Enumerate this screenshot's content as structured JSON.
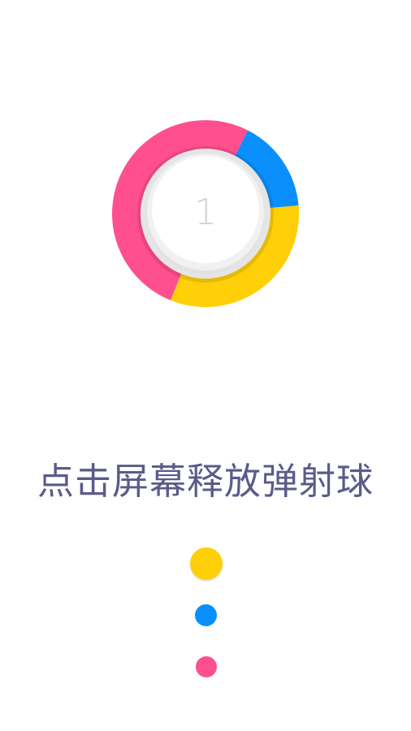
{
  "colors": {
    "pink": "#ff4f8e",
    "blue": "#0a8ffc",
    "yellow": "#ffcf07",
    "background": "#ffffff",
    "text": "#5b5b8a",
    "center_disc": "#ffffff",
    "score_text": "#d2d2d2"
  },
  "wheel": {
    "score": "1",
    "segments": [
      {
        "color_name": "blue",
        "start_deg": -63,
        "end_deg": -5
      },
      {
        "color_name": "yellow",
        "start_deg": -5,
        "end_deg": 112
      },
      {
        "color_name": "pink",
        "start_deg": 112,
        "end_deg": 297
      }
    ]
  },
  "instruction": "点击屏幕释放弹射球",
  "queue": [
    {
      "color_name": "yellow"
    },
    {
      "color_name": "blue"
    },
    {
      "color_name": "pink"
    }
  ]
}
